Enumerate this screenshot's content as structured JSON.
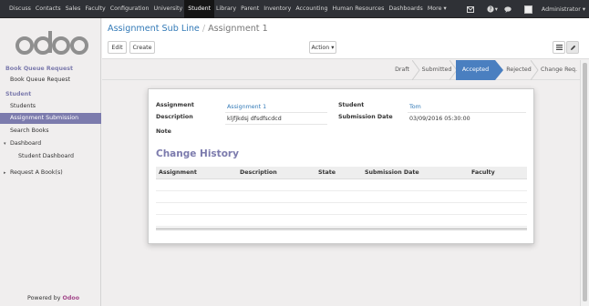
{
  "topbar": {
    "menu": [
      "Discuss",
      "Contacts",
      "Sales",
      "Faculty",
      "Configuration",
      "University",
      "Student",
      "Library",
      "Parent",
      "Inventory",
      "Accounting",
      "Human Resources",
      "Dashboards",
      "More ▾"
    ],
    "active_index": 6,
    "user": "Administrator",
    "user_caret": "▾",
    "help_caret": "▾"
  },
  "sidebar": {
    "logo": "odoo",
    "sections": [
      {
        "title": "Book Queue Request",
        "items": [
          "Book Queue Request"
        ]
      },
      {
        "title": "Student",
        "items": [
          "Students",
          "Assignment Submission",
          "Search Books"
        ]
      }
    ],
    "dashboard": {
      "label": "Dashboard",
      "child": "Student Dashboard"
    },
    "request": {
      "label": "Request A Book(s)"
    },
    "active_item": "Assignment Submission",
    "powered_by": "Powered by",
    "powered_brand": "Odoo"
  },
  "control": {
    "breadcrumb_parent": "Assignment Sub Line",
    "breadcrumb_sep": "/",
    "breadcrumb_current": "Assignment 1",
    "edit_label": "Edit",
    "create_label": "Create",
    "action_label": "Action ▾"
  },
  "status": {
    "stages": [
      "Draft",
      "Submitted",
      "Accepted",
      "Rejected",
      "Change Req."
    ],
    "active_stage": "Accepted"
  },
  "form": {
    "assignment_label": "Assignment",
    "assignment_value": "Assignment 1",
    "description_label": "Description",
    "description_value": "kljfjkdsj dfsdfscdcd",
    "note_label": "Note",
    "student_label": "Student",
    "student_value": "Tom",
    "submission_label": "Submission Date",
    "submission_value": "03/09/2016 05:30:00"
  },
  "history": {
    "title": "Change History",
    "columns": [
      "Assignment",
      "Description",
      "State",
      "Submission Date",
      "Faculty"
    ]
  },
  "colors": {
    "accent": "#7c7bad",
    "link": "#337ab7",
    "active_stage": "#4a7fc0",
    "topbar": "#2f3136"
  }
}
